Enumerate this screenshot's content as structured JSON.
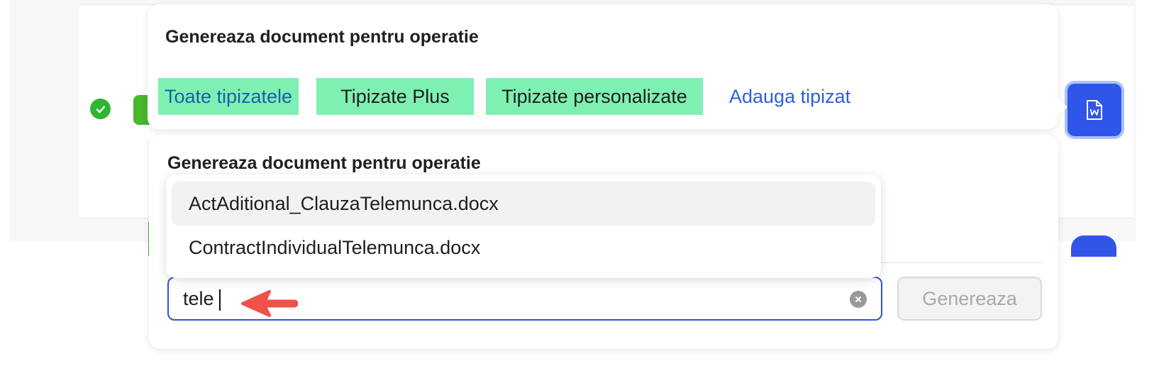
{
  "popover_top": {
    "title": "Genereaza document pentru operatie",
    "tabs": [
      {
        "label": "Toate tipizatele",
        "active": true
      },
      {
        "label": "Tipizate Plus",
        "active": false
      },
      {
        "label": "Tipizate personalizate",
        "active": false
      }
    ],
    "add_link": "Adauga tipizat"
  },
  "popover_main": {
    "title": "Genereaza document pentru operatie",
    "search": {
      "value": "tele"
    },
    "generate_label": "Genereaza"
  },
  "dropdown": {
    "items": [
      {
        "label": "ActAditional_ClauzaTelemunca.docx",
        "highlighted": true
      },
      {
        "label": "ContractIndividualTelemunca.docx",
        "highlighted": false
      }
    ]
  },
  "icons": {
    "word_button": "word-document-icon",
    "status": "check-circle-icon",
    "clear": "clear-circle-icon",
    "annotation": "red-arrow-annotation"
  },
  "colors": {
    "tab_bg": "#7ef0b2",
    "accent_blue": "#2f56e8",
    "link_blue": "#2f5fd8",
    "status_green": "#2fb52f",
    "annotation_red": "#f0524a"
  }
}
